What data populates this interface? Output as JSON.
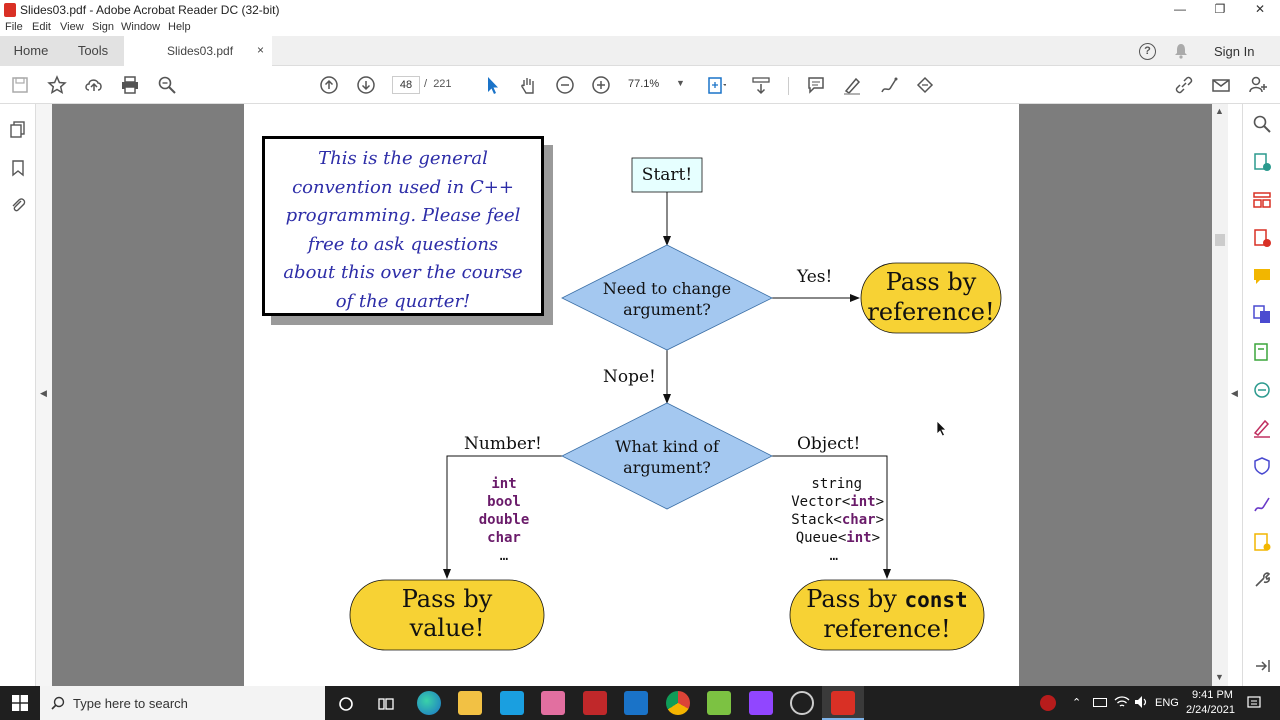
{
  "window": {
    "title": "Slides03.pdf - Adobe Acrobat Reader DC (32-bit)",
    "minimize": "—",
    "maximize": "❐",
    "close": "✕"
  },
  "menu": [
    "File",
    "Edit",
    "View",
    "Sign",
    "Window",
    "Help"
  ],
  "tabs": {
    "home": "Home",
    "tools": "Tools",
    "document": "Slides03.pdf",
    "close": "×",
    "help": "?",
    "sign_in": "Sign In"
  },
  "toolbar": {
    "current_page": "48",
    "separator": "/",
    "total_pages": "221",
    "zoom": "77.1%"
  },
  "slide": {
    "note": [
      "This is the general",
      "convention used in C++",
      "programming. Please feel",
      "free to ask questions",
      "about this over the course",
      "of the quarter!"
    ],
    "start": "Start!",
    "q1": [
      "Need to change",
      "argument?"
    ],
    "yes": "Yes!",
    "by_ref": [
      "Pass by",
      "reference!"
    ],
    "nope": "Nope!",
    "q2": [
      "What kind of",
      "argument?"
    ],
    "number": "Number!",
    "object": "Object!",
    "number_types": [
      "int",
      "bool",
      "double",
      "char",
      "…"
    ],
    "object_types": [
      {
        "pre": "string",
        "kw": "",
        "post": ""
      },
      {
        "pre": "Vector<",
        "kw": "int",
        "post": ">"
      },
      {
        "pre": "Stack<",
        "kw": "char",
        "post": ">"
      },
      {
        "pre": "Queue<",
        "kw": "int",
        "post": ">"
      },
      {
        "pre": "…",
        "kw": "",
        "post": ""
      }
    ],
    "by_value": [
      "Pass by",
      "value!"
    ],
    "by_const_ref": {
      "pre": "Pass by ",
      "kw": "const",
      "line2": "reference!"
    }
  },
  "taskbar": {
    "search_placeholder": "Type here to search",
    "language": "ENG",
    "time": "9:41 PM",
    "date": "2/24/2021"
  },
  "colors": {
    "diamond": "#a4c8f0",
    "terminal": "#f7d234",
    "start_fill": "#e6ffff",
    "note_text": "#2d2da8",
    "keyword": "#6a1b6a"
  }
}
